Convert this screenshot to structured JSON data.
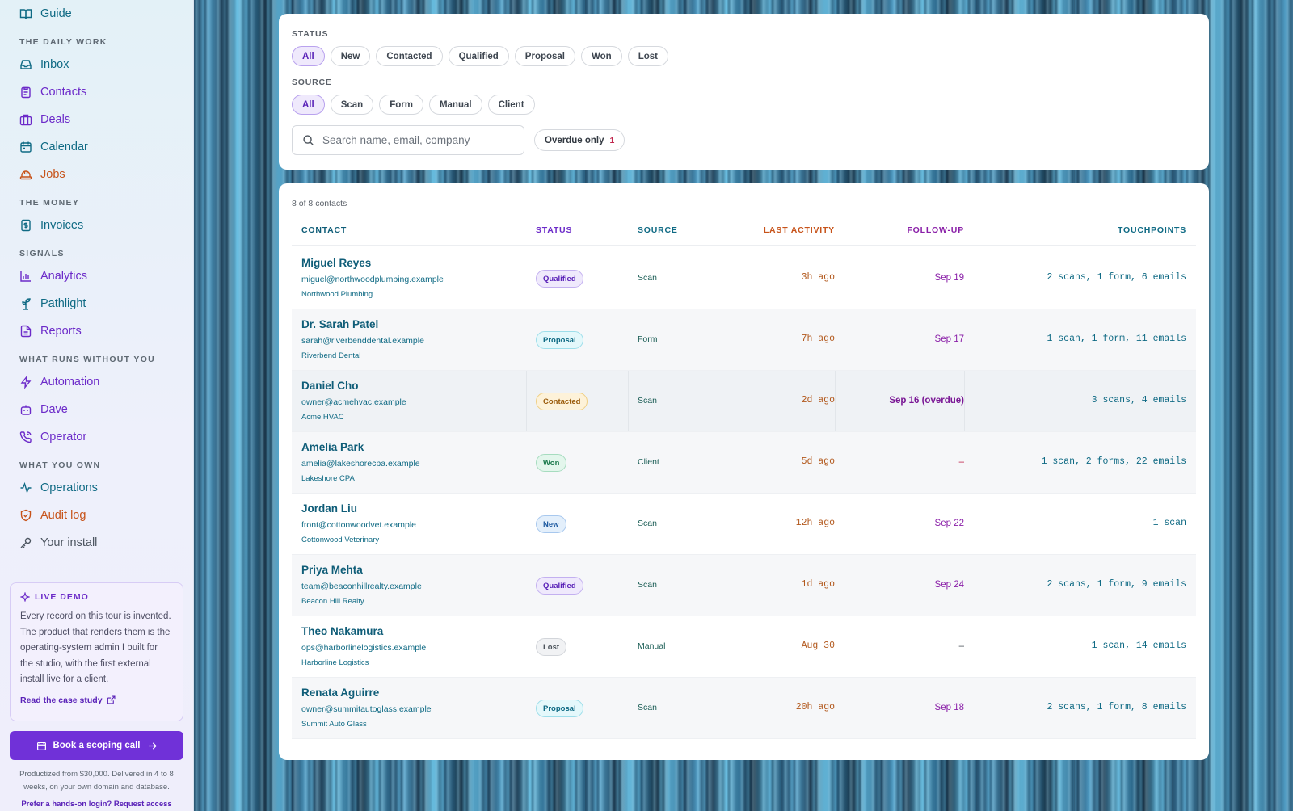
{
  "sidebar": {
    "guide": "Guide",
    "sections": [
      "THE DAILY WORK",
      "THE MONEY",
      "SIGNALS",
      "WHAT RUNS WITHOUT YOU",
      "WHAT YOU OWN"
    ],
    "items": [
      {
        "label": "Inbox",
        "icon": "inbox-icon",
        "color": "#0f6a84"
      },
      {
        "label": "Contacts",
        "icon": "clipboard-icon",
        "color": "#6c2bc9"
      },
      {
        "label": "Deals",
        "icon": "briefcase-icon",
        "color": "#6c2bc9"
      },
      {
        "label": "Calendar",
        "icon": "calendar-icon",
        "color": "#0f6a84"
      },
      {
        "label": "Jobs",
        "icon": "hard-hat-icon",
        "color": "#c7531a"
      },
      {
        "label": "Invoices",
        "icon": "dollar-file-icon",
        "color": "#0f6a84"
      },
      {
        "label": "Analytics",
        "icon": "bar-chart-icon",
        "color": "#6c2bc9"
      },
      {
        "label": "Pathlight",
        "icon": "signpost-icon",
        "color": "#0f6a84"
      },
      {
        "label": "Reports",
        "icon": "report-icon",
        "color": "#6c2bc9"
      },
      {
        "label": "Automation",
        "icon": "lightning-icon",
        "color": "#6c2bc9"
      },
      {
        "label": "Dave",
        "icon": "bot-icon",
        "color": "#6c2bc9"
      },
      {
        "label": "Operator",
        "icon": "phone-icon",
        "color": "#6c2bc9"
      },
      {
        "label": "Operations",
        "icon": "activity-icon",
        "color": "#0f6a84"
      },
      {
        "label": "Audit log",
        "icon": "shield-icon",
        "color": "#c7531a"
      },
      {
        "label": "Your install",
        "icon": "key-icon",
        "color": "#4d5661"
      }
    ],
    "demo": {
      "title": "LIVE DEMO",
      "body": "Every record on this tour is invented. The product that renders them is the operating-system admin I built for the studio, with the first external install live for a client.",
      "link": "Read the case study"
    },
    "cta": "Book a scoping call",
    "cta_note": "Productized from $30,000. Delivered in 4 to 8 weeks, on your own domain and database.",
    "access": "Prefer a hands-on login? Request access"
  },
  "filters": {
    "status_label": "STATUS",
    "status_options": [
      "All",
      "New",
      "Contacted",
      "Qualified",
      "Proposal",
      "Won",
      "Lost"
    ],
    "source_label": "SOURCE",
    "source_options": [
      "All",
      "Scan",
      "Form",
      "Manual",
      "Client"
    ],
    "search_placeholder": "Search name, email, company",
    "overdue_label": "Overdue only",
    "overdue_count": "1"
  },
  "table": {
    "count": "8 of 8 contacts",
    "columns": [
      "CONTACT",
      "STATUS",
      "SOURCE",
      "LAST ACTIVITY",
      "FOLLOW-UP",
      "TOUCHPOINTS"
    ],
    "rows": [
      {
        "name": "Miguel Reyes",
        "email": "miguel@northwoodplumbing.example",
        "company": "Northwood Plumbing",
        "status": "Qualified",
        "source": "Scan",
        "activity": "3h ago",
        "followup": "Sep 19",
        "touchpoints": "2 scans, 1 form, 6 emails"
      },
      {
        "name": "Dr. Sarah Patel",
        "email": "sarah@riverbenddental.example",
        "company": "Riverbend Dental",
        "status": "Proposal",
        "source": "Form",
        "activity": "7h ago",
        "followup": "Sep 17",
        "touchpoints": "1 scan, 1 form, 11 emails"
      },
      {
        "name": "Daniel Cho",
        "email": "owner@acmehvac.example",
        "company": "Acme HVAC",
        "status": "Contacted",
        "source": "Scan",
        "activity": "2d ago",
        "followup": "Sep 16 (overdue)",
        "touchpoints": "3 scans, 4 emails"
      },
      {
        "name": "Amelia Park",
        "email": "amelia@lakeshorecpa.example",
        "company": "Lakeshore CPA",
        "status": "Won",
        "source": "Client",
        "activity": "5d ago",
        "followup": "–",
        "touchpoints": "1 scan, 2 forms, 22 emails"
      },
      {
        "name": "Jordan Liu",
        "email": "front@cottonwoodvet.example",
        "company": "Cottonwood Veterinary",
        "status": "New",
        "source": "Scan",
        "activity": "12h ago",
        "followup": "Sep 22",
        "touchpoints": "1 scan"
      },
      {
        "name": "Priya Mehta",
        "email": "team@beaconhillrealty.example",
        "company": "Beacon Hill Realty",
        "status": "Qualified",
        "source": "Scan",
        "activity": "1d ago",
        "followup": "Sep 24",
        "touchpoints": "2 scans, 1 form, 9 emails"
      },
      {
        "name": "Theo Nakamura",
        "email": "ops@harborlinelogistics.example",
        "company": "Harborline Logistics",
        "status": "Lost",
        "source": "Manual",
        "activity": "Aug 30",
        "followup": "–",
        "touchpoints": "1 scan, 14 emails"
      },
      {
        "name": "Renata Aguirre",
        "email": "owner@summitautoglass.example",
        "company": "Summit Auto Glass",
        "status": "Proposal",
        "source": "Scan",
        "activity": "20h ago",
        "followup": "Sep 18",
        "touchpoints": "2 scans, 1 form, 8 emails"
      }
    ]
  },
  "colors": {
    "accent": "#7031d8",
    "teal": "#0f6a84",
    "orange": "#c7531a"
  }
}
